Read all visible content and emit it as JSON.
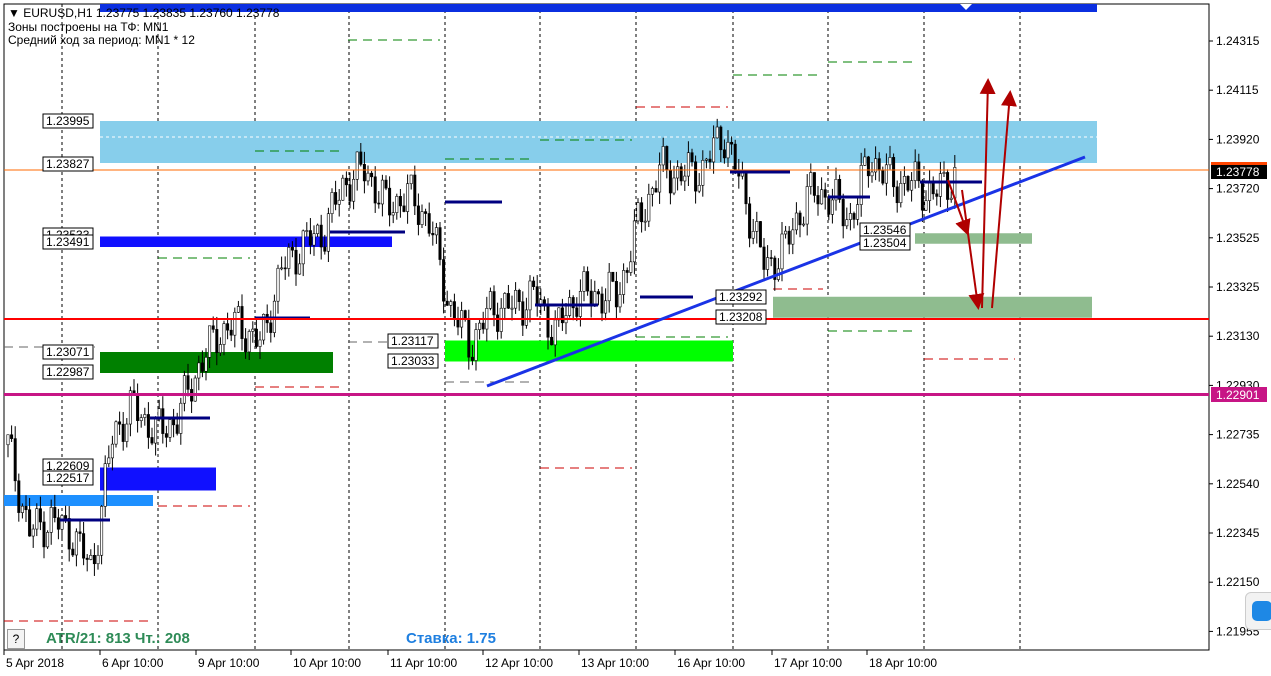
{
  "header": {
    "symbol": "EURUSD,H1",
    "ohlc": "1.23775 1.23835 1.23760 1.23778",
    "zones_line": "Зоны построены на ТФ: MN1",
    "avg_line": "Средний ход за период: MN1 * 12"
  },
  "footer": {
    "help": "?",
    "atr": "ATR/21: 813  Чт.: 208",
    "rate": "Ставка: 1.75"
  },
  "colors": {
    "zone_light": "#87ceeb",
    "zone_blue": "#1010ff",
    "zone_green_dark": "#008000",
    "zone_green": "#00ff00",
    "zone_pale": "#8fbc8f",
    "magenta": "#c71585",
    "trend": "#1a33e6",
    "arrow": "#b00000"
  },
  "chart_data": {
    "type": "candlestick",
    "title": "EURUSD,H1",
    "ylim": [
      1.2192,
      1.2448
    ],
    "y_ticks": [
      "1.24315",
      "1.24115",
      "1.23920",
      "1.23720",
      "1.23525",
      "1.23325",
      "1.23130",
      "1.22930",
      "1.22735",
      "1.22540",
      "1.22345",
      "1.22150",
      "1.21955"
    ],
    "x_ticks": [
      "5 Apr 2018",
      "6 Apr 10:00",
      "9 Apr 10:00",
      "10 Apr 10:00",
      "11 Apr 10:00",
      "12 Apr 10:00",
      "13 Apr 10:00",
      "16 Apr 10:00",
      "17 Apr 10:00",
      "18 Apr 10:00"
    ],
    "price_path": [
      1.227,
      1.2235,
      1.224,
      1.2235,
      1.222,
      1.2275,
      1.2285,
      1.2275,
      1.228,
      1.23,
      1.2315,
      1.2318,
      1.231,
      1.234,
      1.235,
      1.2355,
      1.2375,
      1.238,
      1.2365,
      1.237,
      1.236,
      1.2325,
      1.231,
      1.2325,
      1.2325,
      1.233,
      1.2315,
      1.233,
      1.233,
      1.233,
      1.236,
      1.238,
      1.2378,
      1.238,
      1.2395,
      1.237,
      1.234,
      1.235,
      1.237,
      1.237,
      1.236,
      1.2385,
      1.2375,
      1.2375,
      1.237,
      1.23778
    ],
    "current_price": "1.23778",
    "level_magenta": "1.22901",
    "zone_labels": [
      [
        "1.23995",
        "1.23827"
      ],
      [
        "1.23533",
        "1.23491"
      ],
      [
        "1.23071",
        "1.22987"
      ],
      [
        "1.23117",
        "1.23033"
      ],
      [
        "1.22609",
        "1.22517"
      ],
      [
        "1.23546",
        "1.23504"
      ],
      [
        "1.23292",
        "1.23208"
      ]
    ]
  }
}
